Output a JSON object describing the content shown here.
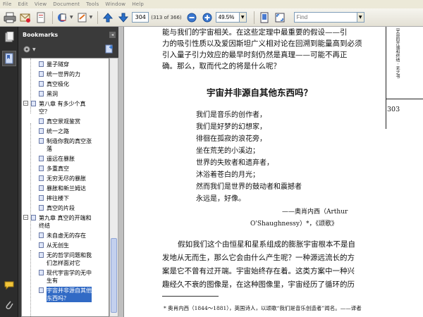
{
  "menu": [
    "File",
    "Edit",
    "View",
    "Document",
    "Tools",
    "Window",
    "Help"
  ],
  "toolbar": {
    "page_current": "304",
    "page_of": "(313 of 366)",
    "zoom": "49.5%",
    "find_placeholder": "Find"
  },
  "bookmarks": {
    "title": "Bookmarks",
    "items": [
      {
        "label": "量子隧穿",
        "level": 2
      },
      {
        "label": "统一世界的力",
        "level": 2
      },
      {
        "label": "真空极化",
        "level": 2
      },
      {
        "label": "黑洞",
        "level": 2
      },
      {
        "label": "第八章 有多少个真\n空？",
        "level": 1,
        "expander": "−"
      },
      {
        "label": "真空景观鉴赏",
        "level": 2
      },
      {
        "label": "统一之路",
        "level": 2
      },
      {
        "label": "制造你我的真空涨\n落",
        "level": 2
      },
      {
        "label": "遥远在暴胀",
        "level": 2
      },
      {
        "label": "多重真空",
        "level": 2
      },
      {
        "label": "无穷无尽的暴胀",
        "level": 2
      },
      {
        "label": "暴胀和新兰姆达",
        "level": 2
      },
      {
        "label": "摔往楼下",
        "level": 2
      },
      {
        "label": "真空的片段",
        "level": 2
      },
      {
        "label": "第九章 真空的开端和\n终结",
        "level": 1,
        "expander": "−"
      },
      {
        "label": "未自虚无的存在",
        "level": 2
      },
      {
        "label": "从无创生",
        "level": 2
      },
      {
        "label": "无的哲学问题和我\n们怎样面对它",
        "level": 2
      },
      {
        "label": "现代宇宙学的无中\n生有",
        "level": 2
      },
      {
        "label": "宇宙并非源自其他\n东西吗？",
        "level": 2,
        "selected": true
      }
    ]
  },
  "page": {
    "intro_lines": [
      "能与我们的宇宙相关。在这些定理中最重要的假设——引",
      "力的吸引性质以及爱因斯坦广义相对论在回溯到能量高到必须",
      "引入量子引力效应的最早时刻仍然是真理——可能不再正",
      "确。那么，取而代之的将是什么呢？"
    ],
    "heading": "宇宙并非源自其他东西吗？",
    "poem": [
      "我们是音乐的创作者，",
      "我们是好梦的幻想家，",
      "徘徊在孤寂的浪花旁，",
      "坐在荒芜的小溪边；",
      "世界的失败者和遗弃者，",
      "沐浴着苍白的月光；",
      "然而我们是世界的鼓动者和震撼者",
      "永远是，好像。"
    ],
    "attribution_1": "——奥肖内西（Arthur",
    "attribution_2": "O'Shaughnessy）*，《颂歌》",
    "body_lines": [
      "假如我们这个由恒星和星系组成的膨胀宇宙根本不是自",
      "发地从无而生，那么它会由什么产生呢？一种源远流长的方",
      "案是它不曾有过开端。宇宙始终存在着。这类方案中一种兴",
      "趣经久不衰的图像是，在这种图像里，宇宙经历了循环的历"
    ],
    "footnote": "* 奥肖内西（1844～1881），英国诗人，以颂歌“我们是音乐创造者”闻名。——译者",
    "running_head": "宇宙的开端和终结 · 无之书",
    "page_number": "303"
  },
  "colors": {
    "panel_bg": "#3a3a3a",
    "selection": "#316ac5",
    "toolbar_arrow": "#2a6fc9"
  }
}
